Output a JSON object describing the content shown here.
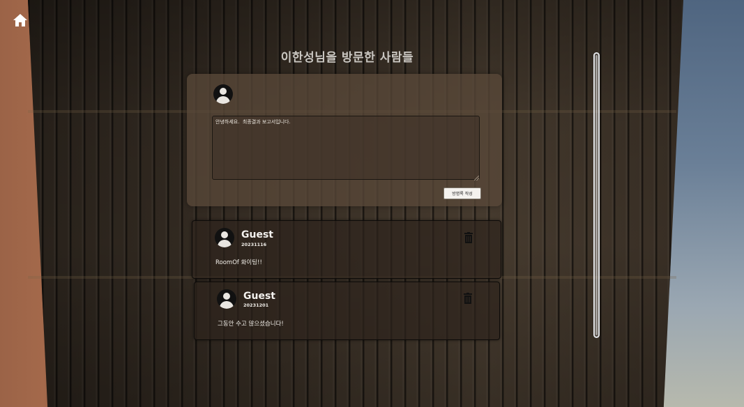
{
  "page": {
    "title": "이한성님을 방문한 사람들"
  },
  "nav": {
    "home_icon": "home-icon"
  },
  "compose": {
    "textarea_value": "안녕하세요.  최종결과 보고서입니다.",
    "submit_label": "방명록 작성",
    "avatar_icon": "user-avatar-icon"
  },
  "entries": [
    {
      "author": "Guest",
      "date": "20231116",
      "message": "RoomOf 화이팅!!",
      "delete_icon": "trash-icon"
    },
    {
      "author": "Guest",
      "date": "20231201",
      "message": "그동안 수고 많으셨습니다!",
      "delete_icon": "trash-icon"
    }
  ],
  "colors": {
    "panel": "#58483a",
    "text": "#f3f1ee",
    "scrollbar": "#e5e7ea"
  }
}
